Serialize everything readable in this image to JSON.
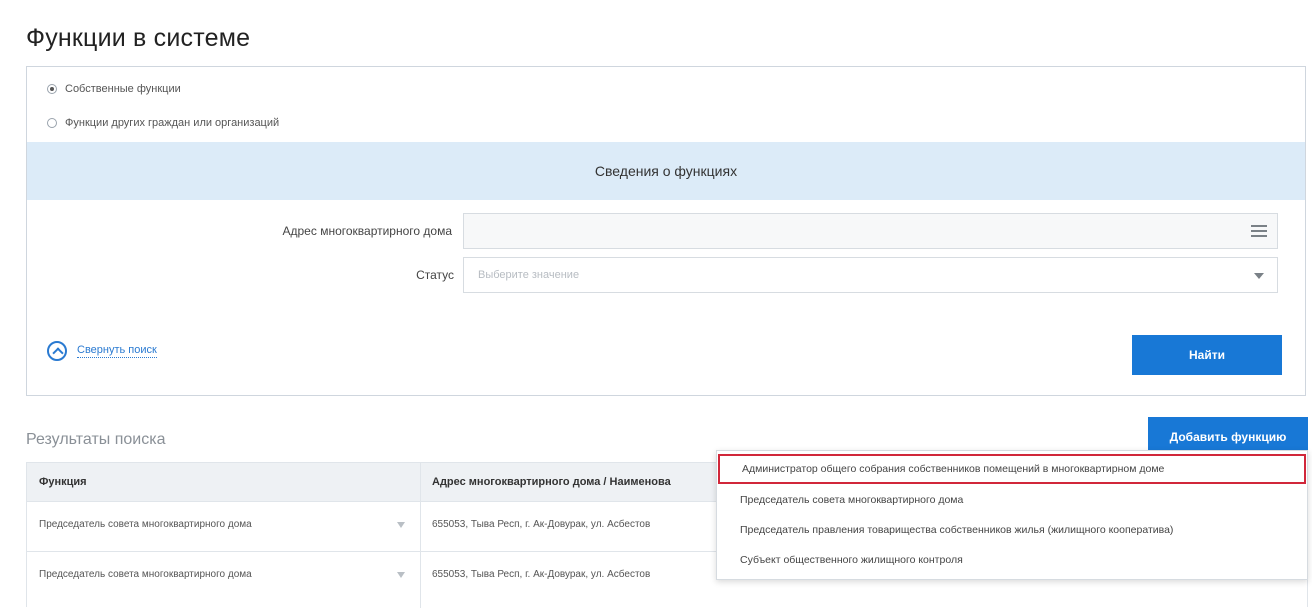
{
  "page_title": "Функции в системе",
  "filter": {
    "radio_options": [
      {
        "label": "Собственные функции",
        "checked": true
      },
      {
        "label": "Функции других граждан или организаций",
        "checked": false
      }
    ],
    "section_title": "Сведения о функциях",
    "fields": {
      "address_label": "Адрес многоквартирного дома",
      "address_value": "",
      "status_label": "Статус",
      "status_placeholder": "Выберите значение"
    },
    "collapse_label": "Свернуть поиск",
    "find_button": "Найти"
  },
  "results": {
    "title": "Результаты поиска",
    "add_button": "Добавить функцию",
    "columns": [
      "Функция",
      "Адрес многоквартирного дома / Наименова"
    ],
    "rows": [
      {
        "function": "Председатель совета многоквартирного дома",
        "address": "655053, Тыва Респ, г. Ак-Довурак, ул. Асбестов"
      },
      {
        "function": "Председатель совета многоквартирного дома",
        "address": "655053, Тыва Респ, г. Ак-Довурак, ул. Асбестов"
      }
    ]
  },
  "dropdown": {
    "items": [
      {
        "label": "Администратор общего собрания собственников помещений в многоквартирном доме",
        "highlighted": true
      },
      {
        "label": "Председатель совета многоквартирного дома",
        "highlighted": false
      },
      {
        "label": "Председатель правления товарищества собственников жилья (жилищного кооператива)",
        "highlighted": false
      },
      {
        "label": "Субъект общественного жилищного контроля",
        "highlighted": false
      }
    ]
  },
  "colors": {
    "accent": "#1878d6",
    "section_bg": "#dcebf8",
    "highlight_border": "#d1273a"
  }
}
